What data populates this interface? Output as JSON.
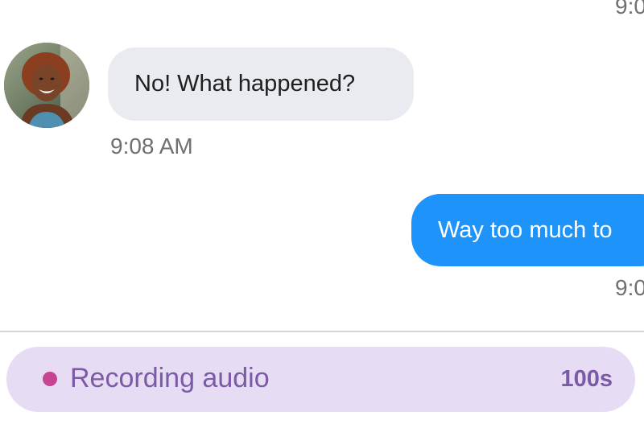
{
  "messages": {
    "top_timestamp": "9:0",
    "incoming": {
      "text": "No! What happened?",
      "timestamp": "9:08 AM",
      "avatar": "person-photo"
    },
    "outgoing": {
      "text": "Way too much to",
      "timestamp": "9:0"
    }
  },
  "recording": {
    "label": "Recording audio",
    "duration": "100s",
    "status_icon": "record-dot-icon"
  },
  "colors": {
    "incoming_bubble": "#e9ebf0",
    "outgoing_bubble": "#1e93fa",
    "recording_bar": "#e6dcf3",
    "recording_text": "#7b5aa6",
    "recording_dot": "#c64590"
  }
}
